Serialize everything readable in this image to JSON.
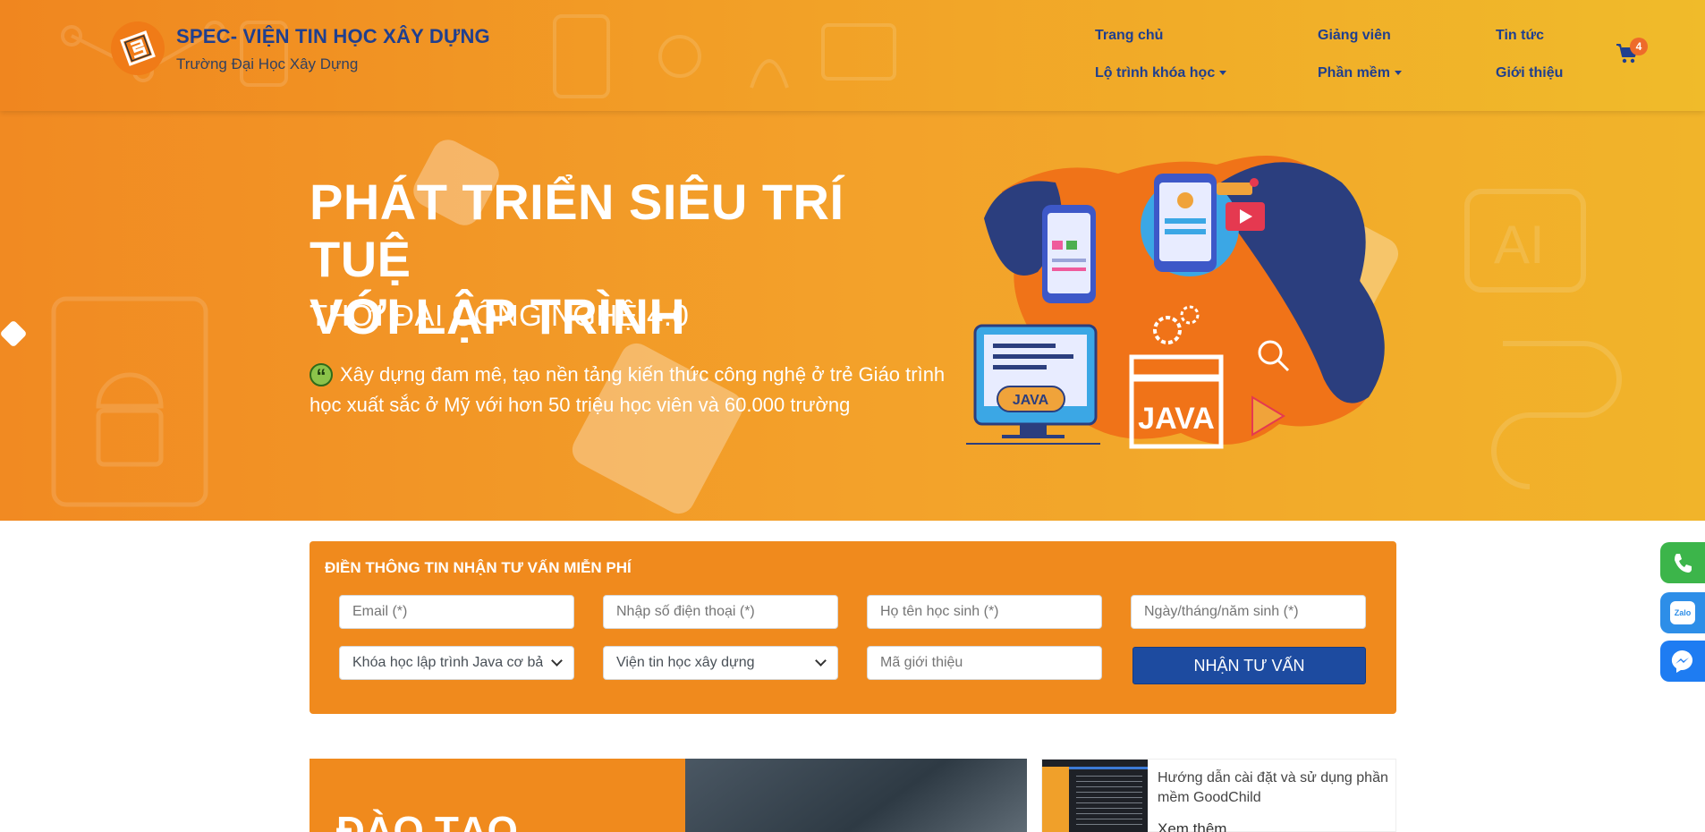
{
  "header": {
    "brand_title": "SPEC- VIỆN TIN HỌC XÂY DỰNG",
    "brand_subtitle": "Trường Đại Học Xây Dựng",
    "nav": {
      "home": "Trang chủ",
      "lecturers": "Giảng viên",
      "news": "Tin tức",
      "course_path": "Lộ trình khóa học",
      "software": "Phần mềm",
      "about": "Giới thiệu"
    },
    "cart_count": "4"
  },
  "hero": {
    "title_line1": "PHÁT TRIỂN SIÊU TRÍ TUỆ",
    "title_line2": "VỚI LẬP TRÌNH",
    "subtitle": "THỜI ĐẠI CÔNG NGHỆ 4.0",
    "description": "Xây dựng đam mê, tạo nền tảng kiến thức công nghệ ở trẻ Giáo trình học xuất sắc ở Mỹ với hơn 50 triệu học viên và 60.000 trường",
    "art_label_1": "JAVA",
    "art_label_2": "JAVA"
  },
  "form": {
    "title": "ĐIỀN THÔNG TIN NHẬN TƯ VẤN MIỄN PHÍ",
    "email_placeholder": "Email (*)",
    "phone_placeholder": "Nhập số điện thoại (*)",
    "name_placeholder": "Họ tên học sinh (*)",
    "dob_placeholder": "Ngày/tháng/năm sinh (*)",
    "course_selected": "Khóa học lập trình Java cơ bả",
    "institute_selected": "Viện tin học xây dựng",
    "referral_placeholder": "Mã giới thiệu",
    "submit_label": "NHẬN TƯ VẤN"
  },
  "cards": {
    "big_title": "ĐÀO TẠO",
    "news_title": "Hướng dẫn cài đặt và sử dụng phần mềm GoodChild",
    "news_more": "Xem thêm"
  },
  "colors": {
    "brand_blue": "#1f3f8f",
    "orange": "#f08a1d",
    "submit_blue": "#1d4ba0",
    "phone_green": "#3cb54a",
    "zalo_blue": "#2d8ee8",
    "messenger_blue": "#1e7cf2"
  },
  "icons": {
    "cart": "shopping-cart-icon",
    "phone": "phone-icon",
    "zalo": "zalo-icon",
    "messenger": "messenger-icon",
    "quote": "quote-icon"
  }
}
